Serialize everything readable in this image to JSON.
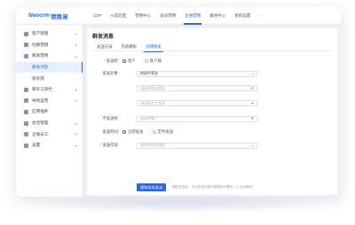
{
  "brand": {
    "name": "Neocrm",
    "product": "销售易"
  },
  "nav": [
    "CDP",
    "AI实验室",
    "营销中心",
    "会员营销",
    "企微营销",
    "素材中心",
    "系统设置",
    "···"
  ],
  "nav_active_index": 4,
  "sidebar": {
    "items": [
      {
        "label": "客户管理",
        "icon": "user-icon",
        "type": "group",
        "arrow": "▾"
      },
      {
        "label": "社群营销",
        "icon": "group-icon",
        "type": "group",
        "arrow": "▾"
      },
      {
        "label": "群发营销",
        "icon": "send-icon",
        "type": "group",
        "arrow": "▴"
      },
      {
        "label": "群发消息",
        "type": "sub",
        "active": true
      },
      {
        "label": "朋友圈",
        "type": "sub"
      },
      {
        "label": "聊天工具栏",
        "icon": "chat-icon",
        "type": "group",
        "arrow": "▾"
      },
      {
        "label": "导购运营",
        "icon": "guide-icon",
        "type": "group",
        "arrow": "▾"
      },
      {
        "label": "应用插件",
        "icon": "plugin-icon",
        "type": "group",
        "arrow": ""
      },
      {
        "label": "会话管理",
        "icon": "session-icon",
        "type": "group",
        "arrow": "▾"
      },
      {
        "label": "企微员工",
        "icon": "staff-icon",
        "type": "group",
        "arrow": "▾"
      },
      {
        "label": "设置",
        "icon": "gear-icon",
        "type": "group",
        "arrow": "▾"
      }
    ]
  },
  "page": {
    "title": "群发消息"
  },
  "tabs": [
    "发送记录",
    "内容模板",
    "创建群发"
  ],
  "tab_active_index": 2,
  "form": {
    "target": {
      "label": "发送给:",
      "options": [
        "客户",
        "客户群"
      ],
      "selected": 0
    },
    "filter": {
      "label": "发送对象:",
      "value": "按条件筛选"
    },
    "row2_placeholder": "请选择使用筛选",
    "row3_placeholder": "请选择员工筛选",
    "exclude": {
      "label": "不发送给:",
      "placeholder": "请选择客户"
    },
    "time": {
      "label": "发送时间:",
      "options": [
        "立即发送",
        "定时发送"
      ],
      "selected": 0
    },
    "content": {
      "label": "发送内容:",
      "placeholder": "请选择内容模板"
    },
    "add_icon": "plus-icon",
    "caret_icon": "chevron-down-icon"
  },
  "submit": {
    "label": "通知成员发送",
    "hint": "通知发送后，可在发送记录中查看执行情况（上企业微信）"
  },
  "colors": {
    "accent": "#2a66e0",
    "required": "#e34d4d"
  }
}
